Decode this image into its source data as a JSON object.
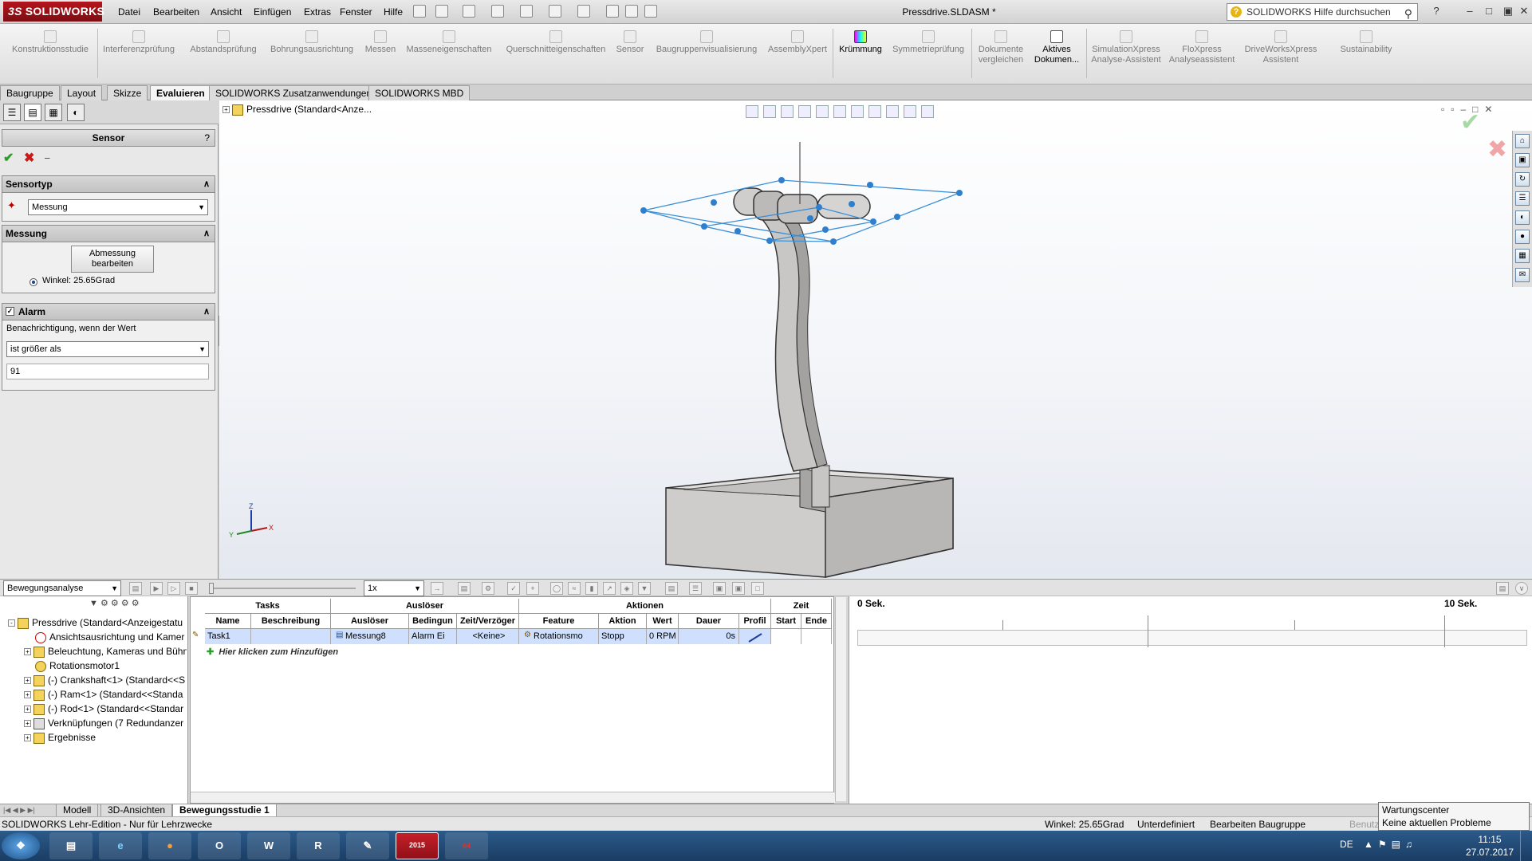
{
  "app": {
    "logo_text": "SOLIDWORKS",
    "logo_prefix": "3S"
  },
  "menu": [
    "Datei",
    "Bearbeiten",
    "Ansicht",
    "Einfügen",
    "Extras",
    "Fenster",
    "Hilfe"
  ],
  "document_title": "Pressdrive.SLDASM *",
  "help_search_placeholder": "SOLIDWORKS Hilfe durchsuchen",
  "ribbon": {
    "konstruktionsstudie": "Konstruktionsstudie",
    "items": [
      {
        "label": "Interferenzprüfung",
        "icon": "interference-icon"
      },
      {
        "label": "Abstandsprüfung",
        "icon": "clearance-icon"
      },
      {
        "label": "Bohrungsausrichtung",
        "icon": "hole-icon"
      },
      {
        "label": "Messen",
        "icon": "measure-icon"
      },
      {
        "label": "Masseneigenschaften",
        "icon": "mass-icon"
      },
      {
        "label": "Querschnitteigenschaften",
        "icon": "section-icon"
      },
      {
        "label": "Sensor",
        "icon": "sensor-icon"
      },
      {
        "label": "Baugruppenvisualisierung",
        "icon": "visualize-icon"
      },
      {
        "label": "AssemblyXpert",
        "icon": "xpert-icon"
      },
      {
        "label": "Krümmung",
        "icon": "curvature-icon"
      },
      {
        "label": "Symmetrieprüfung",
        "icon": "symmetry-icon"
      },
      {
        "label": "Dokumente vergleichen",
        "icon": "compare-icon"
      },
      {
        "label": "Aktives Dokumen...",
        "icon": "active-doc-icon"
      },
      {
        "label": "SimulationXpress Analyse-Assistent",
        "icon": "simulation-icon"
      },
      {
        "label": "FloXpress Analyseassistent",
        "icon": "flow-icon"
      },
      {
        "label": "DriveWorksXpress Assistent",
        "icon": "driveworks-icon"
      },
      {
        "label": "Sustainability",
        "icon": "sustainability-icon"
      }
    ]
  },
  "command_tabs": [
    "Baugruppe",
    "Layout",
    "Skizze",
    "Evaluieren",
    "SOLIDWORKS Zusatzanwendungen",
    "SOLIDWORKS MBD"
  ],
  "active_command_tab": "Evaluieren",
  "property_manager": {
    "title": "Sensor",
    "help": "?",
    "sensortyp_header": "Sensortyp",
    "sensortyp_value": "Messung",
    "messung_header": "Messung",
    "edit_button": "Abmessung bearbeiten",
    "winkel": "Winkel: 25.65Grad",
    "alarm_header": "Alarm",
    "alarm_label": "Benachrichtigung, wenn der Wert",
    "alarm_condition": "ist größer als",
    "alarm_value": "91"
  },
  "tree_top": "Pressdrive  (Standard<Anze...",
  "motion": {
    "study_type": "Bewegungsanalyse",
    "speed": "1x",
    "tree": [
      {
        "label": "Pressdrive  (Standard<Anzeigestatu",
        "icon": "assembly-icon",
        "level": 0,
        "expand": "-"
      },
      {
        "label": "Ansichtsausrichtung und Kamer",
        "icon": "camera-icon",
        "level": 1,
        "expand": ""
      },
      {
        "label": "Beleuchtung, Kameras und Bühn",
        "icon": "lights-icon",
        "level": 1,
        "expand": "+"
      },
      {
        "label": "Rotationsmotor1",
        "icon": "motor-icon",
        "level": 1,
        "expand": ""
      },
      {
        "label": "(-) Crankshaft<1> (Standard<<S",
        "icon": "part-icon",
        "level": 1,
        "expand": "+"
      },
      {
        "label": "(-) Ram<1> (Standard<<Standa",
        "icon": "part-icon",
        "level": 1,
        "expand": "+"
      },
      {
        "label": "(-) Rod<1> (Standard<<Standar",
        "icon": "part-icon",
        "level": 1,
        "expand": "+"
      },
      {
        "label": "Verknüpfungen (7 Redundanzer",
        "icon": "mates-icon",
        "level": 1,
        "expand": "+"
      },
      {
        "label": "Ergebnisse",
        "icon": "results-icon",
        "level": 1,
        "expand": "+"
      }
    ],
    "table": {
      "groups": [
        "Tasks",
        "Auslöser",
        "Aktionen",
        "Zeit"
      ],
      "columns": [
        "Name",
        "Beschreibung",
        "Auslöser",
        "Bedingun",
        "Zeit/Verzöger",
        "Feature",
        "Aktion",
        "Wert",
        "Dauer",
        "Profil",
        "Start",
        "Ende"
      ],
      "row": {
        "name": "Task1",
        "beschreibung": "",
        "ausloeser": "Messung8",
        "bedingung": "Alarm Ei",
        "zeit": "<Keine>",
        "feature": "Rotationsmo",
        "aktion": "Stopp",
        "wert": "0 RPM",
        "dauer": "0s",
        "profil": "",
        "start": "",
        "ende": ""
      },
      "add_row": "Hier klicken zum Hinzufügen"
    },
    "timeline": {
      "start": "0 Sek.",
      "end": "10 Sek."
    }
  },
  "bottom_tabs": [
    "Modell",
    "3D-Ansichten",
    "Bewegungsstudie 1"
  ],
  "active_bottom_tab": "Bewegungsstudie 1",
  "status": {
    "left": "SOLIDWORKS Lehr-Edition - Nur für Lehrzwecke",
    "winkel": "Winkel: 25.65Grad",
    "state": "Unterdefiniert",
    "mode": "Bearbeiten Baugruppe",
    "benutz": "Benutz"
  },
  "tooltip": {
    "title": "Wartungscenter",
    "text": "Keine aktuellen Probleme erkannt"
  },
  "taskbar": {
    "lang": "DE",
    "time": "11:15",
    "date": "27.07.2017",
    "sw_badge": "2015",
    "sw_badge_64": "64"
  },
  "colors": {
    "brand": "#b4151c",
    "selection": "#cfe0ff",
    "sensor_blue": "#3a8fd6"
  }
}
